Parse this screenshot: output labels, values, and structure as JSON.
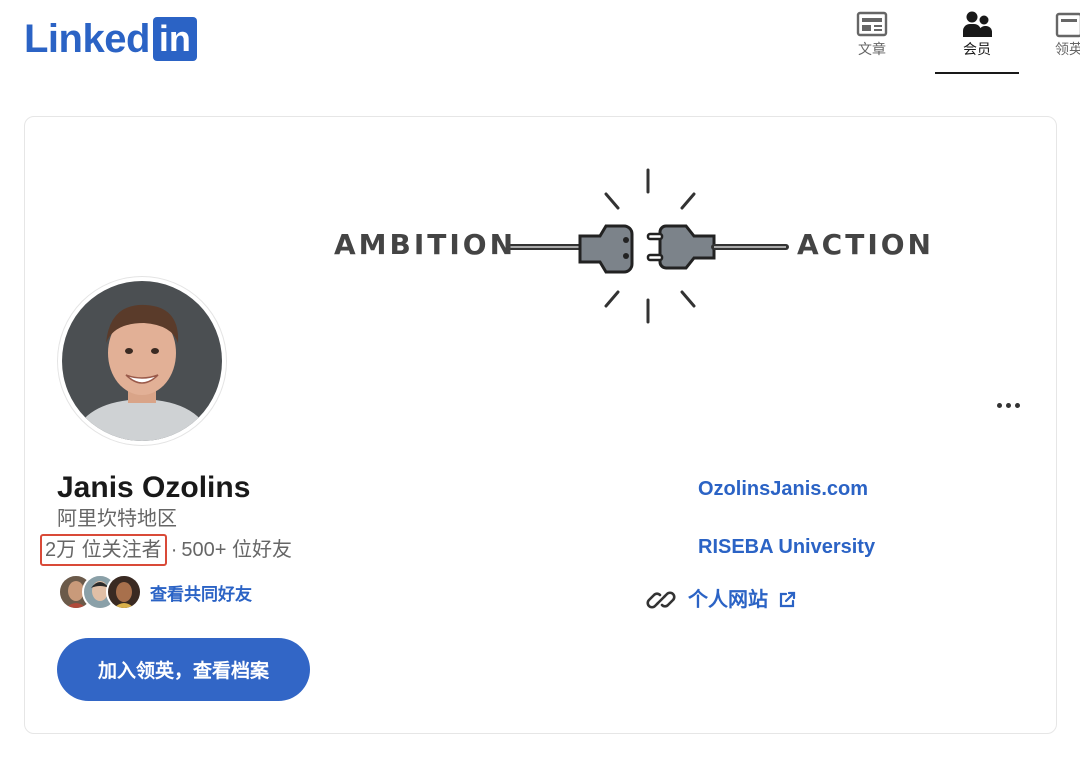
{
  "header": {
    "logo_text": "Linked",
    "logo_box": "in",
    "nav": [
      {
        "label": "文章",
        "icon": "article-icon"
      },
      {
        "label": "会员",
        "icon": "people-icon",
        "active": true
      },
      {
        "label": "领英",
        "icon": "briefcase-icon"
      }
    ]
  },
  "banner": {
    "left_word": "AMBITION",
    "right_word": "ACTION"
  },
  "profile": {
    "name": "Janis Ozolins",
    "location": "阿里坎特地区",
    "followers": "2万 位关注者",
    "separator": "·",
    "connections": "500+ 位好友",
    "mutual_link": "查看共同好友",
    "join_button": "加入领英，查看档案"
  },
  "side": {
    "website": "OzolinsJanis.com",
    "university": "RISEBA University",
    "personal_site": "个人网站"
  },
  "colors": {
    "brand": "#2b63c5",
    "button": "#3266c6",
    "highlight": "#d94a38"
  }
}
